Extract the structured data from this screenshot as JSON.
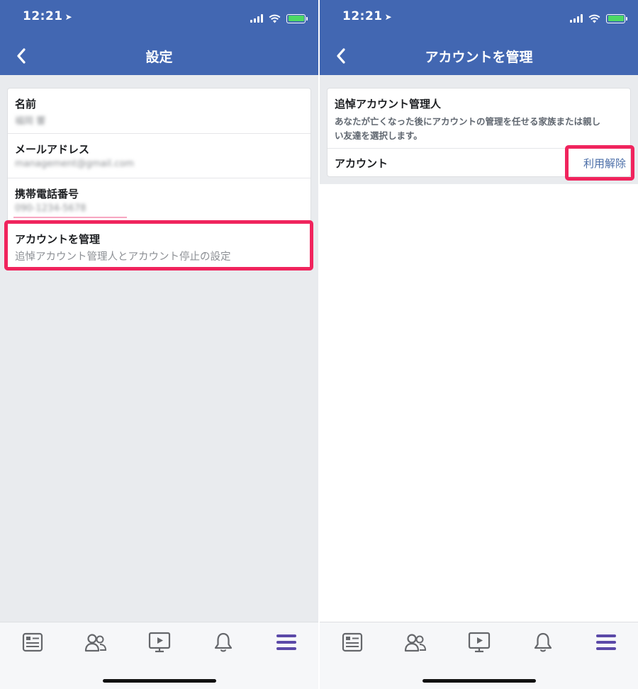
{
  "left": {
    "status": {
      "time": "12:21"
    },
    "nav": {
      "title": "設定"
    },
    "rows": [
      {
        "label": "名前",
        "value": "福岡 響"
      },
      {
        "label": "メールアドレス",
        "value": "management@gmail.com"
      },
      {
        "label": "携帯電話番号",
        "value": "090-1234-5678"
      },
      {
        "label": "アカウントを管理",
        "sub": "追悼アカウント管理人とアカウント停止の設定"
      }
    ]
  },
  "right": {
    "status": {
      "time": "12:21"
    },
    "nav": {
      "title": "アカウントを管理"
    },
    "card": {
      "title": "追悼アカウント管理人",
      "description_line1": "あなたが亡くなった後にアカウントの管理を任せる家族または親し",
      "description_line2": "い友達を選択します。",
      "account_label": "アカウント",
      "release_button": "利用解除"
    }
  },
  "tabbar": {
    "tabs": [
      {
        "icon": "news-feed-icon"
      },
      {
        "icon": "friends-icon"
      },
      {
        "icon": "watch-video-icon"
      },
      {
        "icon": "notifications-bell-icon"
      },
      {
        "icon": "menu-icon",
        "active": true
      }
    ]
  },
  "colors": {
    "brand_blue": "#4267b2",
    "highlight": "#f0245d",
    "active_tab": "#5b49a8",
    "background": "#e9ebee"
  }
}
